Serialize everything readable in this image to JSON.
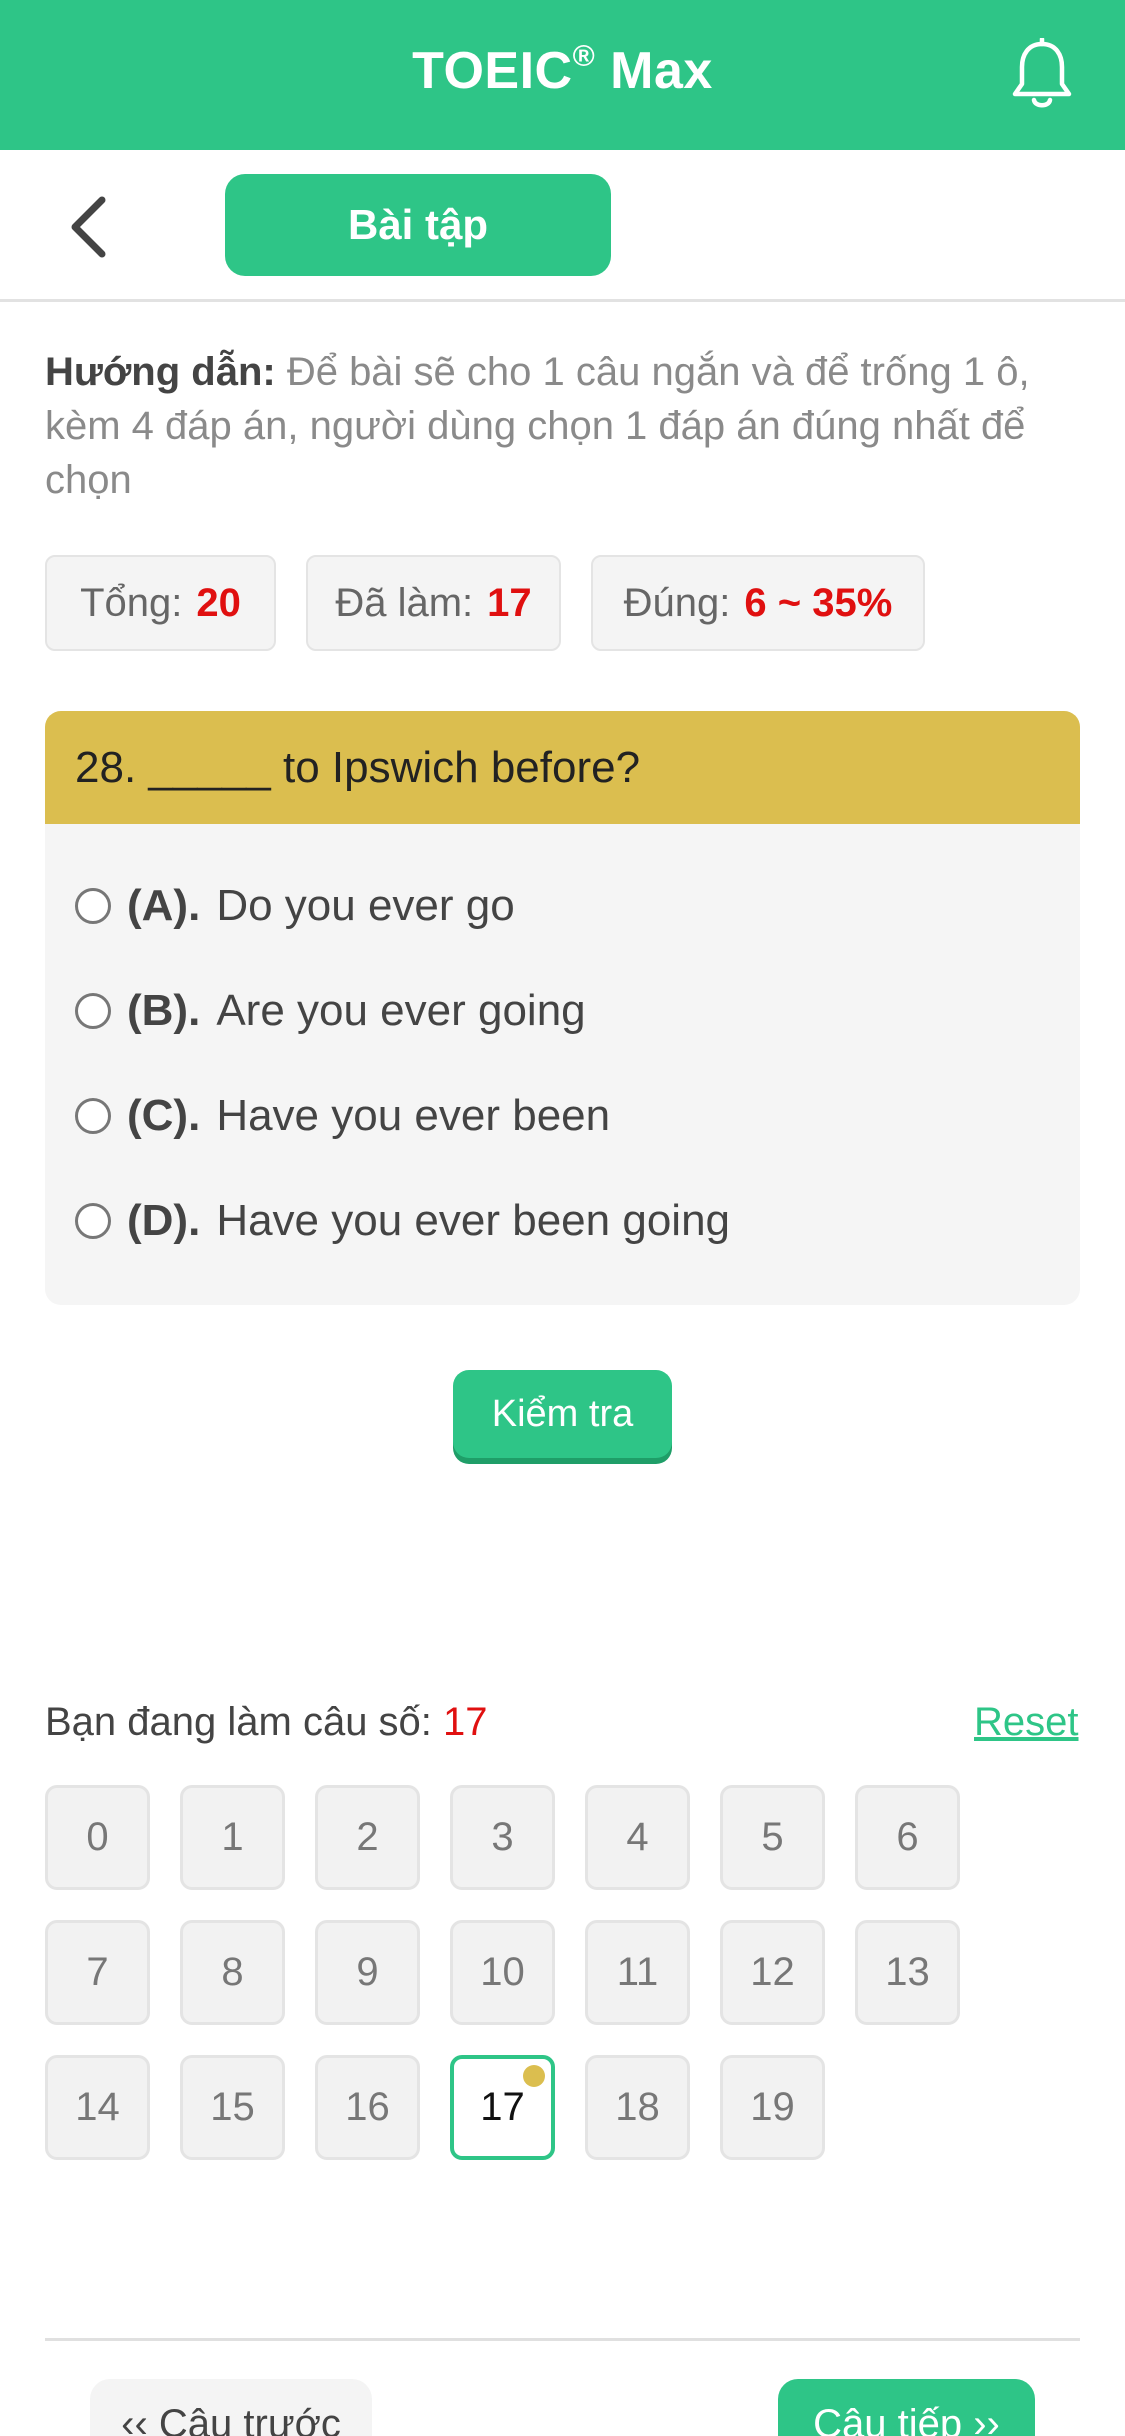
{
  "header": {
    "title": "TOEIC",
    "title_mark": "®",
    "title_suffix": " Max",
    "bell_icon": "bell-icon",
    "color": "#2ec587"
  },
  "subbar": {
    "back_icon": "chevron-left-icon",
    "tab_label": "Bài tập"
  },
  "instructions": {
    "label": "Hướng dẫn:",
    "text": " Để bài sẽ cho 1 câu ngắn và để trống 1 ô, kèm 4 đáp án, người dùng chọn 1 đáp án đúng nhất để chọn"
  },
  "stats": {
    "total_label": "Tổng:",
    "total_value": "20",
    "done_label": "Đã làm:",
    "done_value": "17",
    "correct_label": "Đúng:",
    "correct_value": "6 ~ 35%"
  },
  "question": {
    "text": "28. _____ to Ipswich before?",
    "options": [
      {
        "key": "(A).",
        "text": "Do you ever go"
      },
      {
        "key": "(B).",
        "text": "Are you ever going"
      },
      {
        "key": "(C).",
        "text": "Have you ever been"
      },
      {
        "key": "(D).",
        "text": "Have you ever been going"
      }
    ]
  },
  "check_button": "Kiểm tra",
  "navigator": {
    "status_label": "Bạn đang làm câu số:",
    "current": "17",
    "reset_label": "Reset",
    "numbers": [
      "0",
      "1",
      "2",
      "3",
      "4",
      "5",
      "6",
      "7",
      "8",
      "9",
      "10",
      "11",
      "12",
      "13",
      "14",
      "15",
      "16",
      "17",
      "18",
      "19"
    ],
    "active_index": 17
  },
  "footer": {
    "prev_label": "‹‹ Câu trước",
    "next_label": "Câu tiếp ››"
  }
}
